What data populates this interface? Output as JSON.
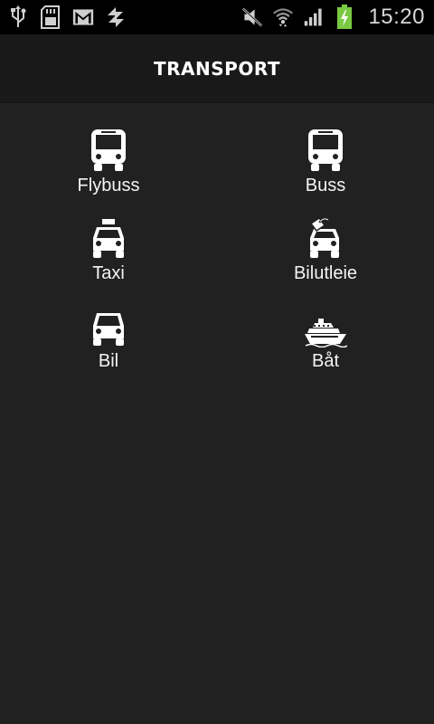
{
  "status_bar": {
    "time": "15:20",
    "left_icons": [
      "usb-icon",
      "sd-card-icon",
      "gmail-icon",
      "sync-icon"
    ],
    "right_icons": [
      "mute-icon",
      "wifi-icon",
      "signal-icon",
      "battery-charging-icon"
    ],
    "battery_color": "#7ac943"
  },
  "header": {
    "title": "TRANSPORT"
  },
  "items": [
    {
      "label": "Flybuss",
      "icon": "bus-icon"
    },
    {
      "label": "Buss",
      "icon": "bus-icon"
    },
    {
      "label": "Taxi",
      "icon": "taxi-icon"
    },
    {
      "label": "Bilutleie",
      "icon": "car-rental-icon"
    },
    {
      "label": "Bil",
      "icon": "car-icon"
    },
    {
      "label": "Båt",
      "icon": "ship-icon"
    }
  ]
}
